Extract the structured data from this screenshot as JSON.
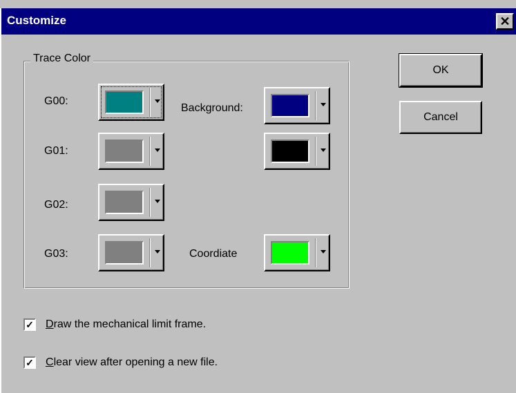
{
  "window": {
    "title": "Customize",
    "close_icon": "close-icon"
  },
  "group": {
    "label": "Trace Color"
  },
  "colors": {
    "g00": {
      "label": "G00:",
      "color": "#008080"
    },
    "g01": {
      "label": "G01:",
      "color": "#808080"
    },
    "g02": {
      "label": "G02:",
      "color": "#808080"
    },
    "g03": {
      "label": "G03:",
      "color": "#808080"
    },
    "background": {
      "label": "Background:",
      "color": "#000080"
    },
    "background2": {
      "color": "#000000"
    },
    "coordinate": {
      "label": "Coordiate",
      "color": "#00ff00"
    }
  },
  "buttons": {
    "ok": "OK",
    "cancel": "Cancel"
  },
  "options": {
    "draw_frame": {
      "mnemonic": "D",
      "rest": "raw the mechanical limit frame.",
      "checked": true
    },
    "clear_view": {
      "mnemonic": "C",
      "rest": "lear view after opening a new file.",
      "checked": true
    }
  }
}
